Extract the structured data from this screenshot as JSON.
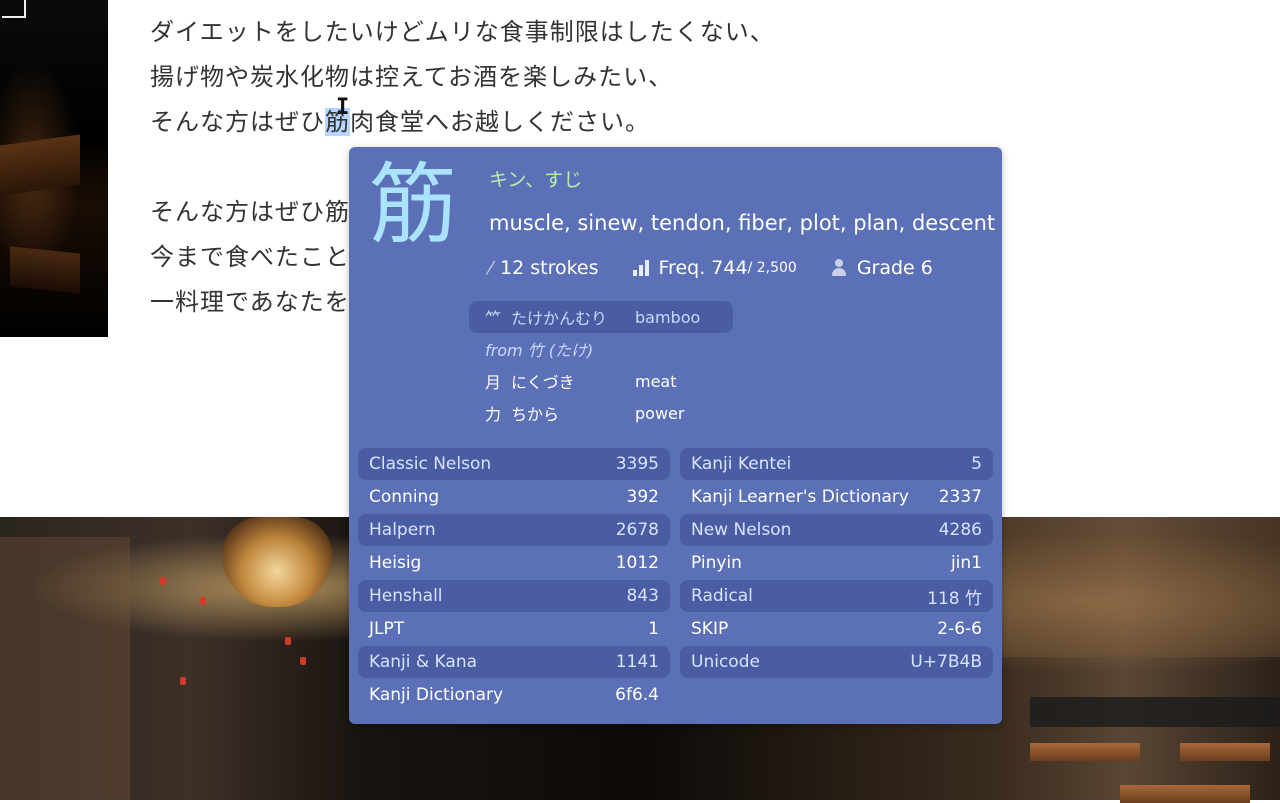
{
  "page_text": {
    "lines": [
      "ダイエットをしたいけどムリな食事制限はしたくない、",
      "揚げ物や炭水化物は控えてお酒を楽しみたい、",
      "そんな方はぜひ",
      "筋",
      "肉食堂へお越しください。",
      "そんな方はぜひ筋",
      "今まで食べたこと",
      "一料理であなたを"
    ]
  },
  "popup": {
    "kanji": "筋",
    "readings": "キン、すじ",
    "meanings": "muscle, sinew, tendon, fiber, plot, plan, descent",
    "strokes": "12 strokes",
    "freq_label": "Freq. 744",
    "freq_total": " / 2,500",
    "grade": "Grade 6",
    "radical": {
      "char": "⺮",
      "reading": "たけかんむり",
      "meaning": "bamboo"
    },
    "from": "from 竹 (たけ)",
    "components": [
      {
        "char": "月",
        "reading": "にくづき",
        "meaning": "meat"
      },
      {
        "char": "力",
        "reading": "ちから",
        "meaning": "power"
      }
    ],
    "refs_left": [
      {
        "label": "Classic Nelson",
        "value": "3395"
      },
      {
        "label": "Conning",
        "value": "392"
      },
      {
        "label": "Halpern",
        "value": "2678"
      },
      {
        "label": "Heisig",
        "value": "1012"
      },
      {
        "label": "Henshall",
        "value": "843"
      },
      {
        "label": "JLPT",
        "value": "1"
      },
      {
        "label": "Kanji & Kana",
        "value": "1141"
      },
      {
        "label": "Kanji Dictionary",
        "value": "6f6.4"
      }
    ],
    "refs_right": [
      {
        "label": "Kanji Kentei",
        "value": "5"
      },
      {
        "label": "Kanji Learner's Dictionary",
        "value": "2337"
      },
      {
        "label": "New Nelson",
        "value": "4286"
      },
      {
        "label": "Pinyin",
        "value": "jin1"
      },
      {
        "label": "Radical",
        "value": "118 竹"
      },
      {
        "label": "SKIP",
        "value": "2-6-6"
      },
      {
        "label": "Unicode",
        "value": "U+7B4B"
      }
    ]
  },
  "colors": {
    "popup_bg": "#5b70b6",
    "row_alt": "#4a5da3",
    "kanji": "#a9e3ff",
    "readings": "#b8f0a8",
    "highlight": "#b6d6ff"
  },
  "icons": [
    "pencil-icon",
    "frequency-bars-icon",
    "person-icon",
    "text-cursor-icon"
  ]
}
